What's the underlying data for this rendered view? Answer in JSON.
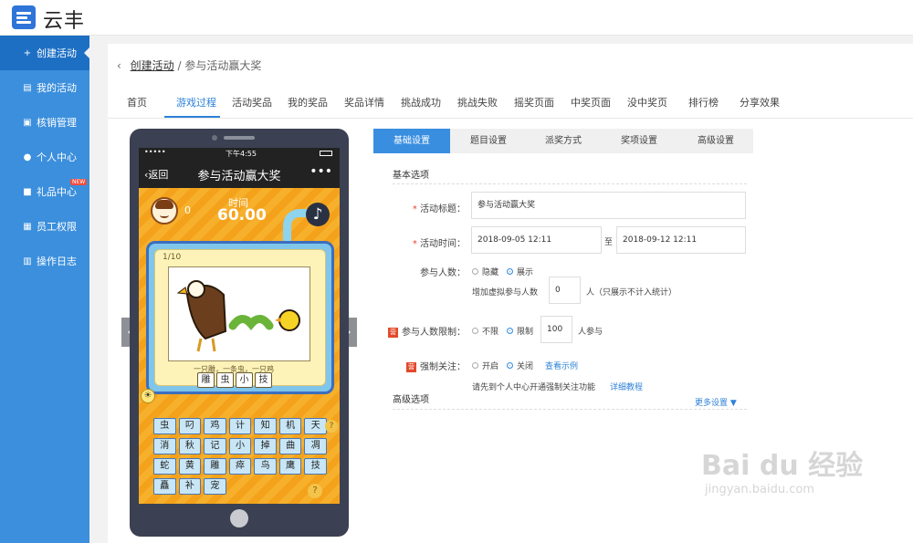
{
  "app": {
    "logo_text": "云丰"
  },
  "sidebar": {
    "items": [
      {
        "label": "创建活动",
        "icon": "plus-icon",
        "active": true
      },
      {
        "label": "我的活动",
        "icon": "document-icon"
      },
      {
        "label": "核销管理",
        "icon": "ticket-icon"
      },
      {
        "label": "个人中心",
        "icon": "user-icon"
      },
      {
        "label": "礼品中心",
        "icon": "gift-icon",
        "badge": "NEW"
      },
      {
        "label": "员工权限",
        "icon": "staff-icon"
      },
      {
        "label": "操作日志",
        "icon": "log-icon"
      }
    ]
  },
  "breadcrumb": {
    "parent": "创建活动",
    "separator": "/",
    "current": "参与活动赢大奖"
  },
  "tabs": [
    "首页",
    "游戏过程",
    "活动奖品",
    "我的奖品",
    "奖品详情",
    "挑战成功",
    "挑战失败",
    "摇奖页面",
    "中奖页面",
    "没中奖页",
    "排行榜",
    "分享效果"
  ],
  "active_tab": "游戏过程",
  "phone": {
    "status_time": "下午4:55",
    "nav_back": "返回",
    "nav_title": "参与活动赢大奖",
    "nav_more": "•••",
    "score": "0",
    "time_label": "时间",
    "time_value": "60.00",
    "progress": "1/10",
    "caption": "一只雕，一条虫，一只鸡",
    "answer": [
      "雕",
      "虫",
      "小",
      "技"
    ],
    "keys": [
      "虫",
      "叼",
      "鸡",
      "计",
      "知",
      "机",
      "天",
      "消",
      "秋",
      "记",
      "小",
      "掉",
      "曲",
      "凋",
      "蛇",
      "黄",
      "雕",
      "瘁",
      "鸟",
      "鹰",
      "技",
      "矗",
      "补",
      "宠"
    ]
  },
  "form": {
    "tabs": [
      "基础设置",
      "题目设置",
      "派奖方式",
      "奖项设置",
      "高级设置"
    ],
    "basic_title": "基本选项",
    "title_label": "活动标题：",
    "title_value": "参与活动赢大奖",
    "time_label": "活动时间：",
    "start": "2018-09-05 12:11",
    "to": "至",
    "end": "2018-09-12 12:11",
    "participants_label": "参与人数：",
    "hide": "隐藏",
    "show": "展示",
    "virtual_label": "增加虚拟参与人数",
    "virtual_value": "0",
    "virtual_unit": "人（只展示不计入统计）",
    "limit_label": "参与人数限制：",
    "no_limit": "不限",
    "limit": "限制",
    "limit_value": "100",
    "limit_unit": "人参与",
    "follow_label": "强制关注：",
    "on": "开启",
    "off": "关闭",
    "example": "查看示例",
    "follow_hint": "请先到个人中心开通强制关注功能",
    "tutorial": "详细教程",
    "advanced_title": "高级选项",
    "more": "更多设置 ▼",
    "vip": "营"
  },
  "watermark": {
    "big": "Bai  du 经验",
    "small": "jingyan.baidu.com"
  }
}
